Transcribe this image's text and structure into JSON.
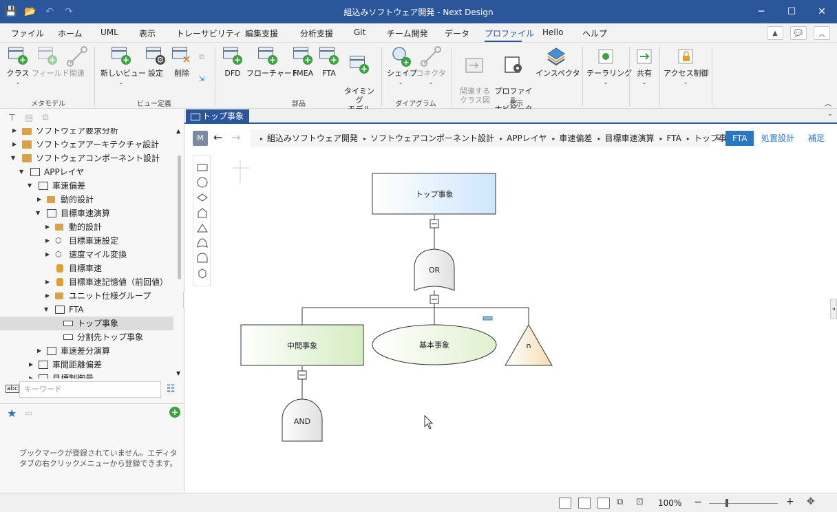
{
  "window": {
    "title": "組込みソフトウェア開発 - Next Design"
  },
  "menu": {
    "items": [
      "ファイル",
      "ホーム",
      "UML",
      "表示",
      "トレーサビリティ",
      "編集支援",
      "分析支援",
      "Git",
      "チーム開発",
      "データ",
      "プロファイル",
      "Hello",
      "ヘルプ"
    ],
    "active": "プロファイル"
  },
  "ribbon": {
    "groups": [
      {
        "label": "メタモデル",
        "buttons": [
          "クラス",
          "フィールド",
          "関連"
        ]
      },
      {
        "label": "ビュー定義",
        "buttons": [
          "新しいビュー",
          "設定",
          "削除"
        ]
      },
      {
        "label": "部品",
        "buttons": [
          "DFD",
          "フローチャート",
          "FMEA",
          "FTA",
          "タイミング\nモデル"
        ]
      },
      {
        "label": "ダイアグラム",
        "buttons": [
          "シェイプ",
          "コネクタ"
        ]
      },
      {
        "label": "表示",
        "buttons": [
          "関連する\nクラス図",
          "プロファイル\nナビゲータ",
          "インスペクタ"
        ]
      },
      {
        "label": "",
        "buttons": [
          "テーラリング"
        ]
      },
      {
        "label": "",
        "buttons": [
          "共有"
        ]
      },
      {
        "label": "",
        "buttons": [
          "アクセス制御"
        ]
      }
    ]
  },
  "tree": [
    "ソフトウェア要求分析",
    "ソフトウェアアーキテクチャ設計",
    "ソフトウェアコンポーネント設計",
    "APPレイヤ",
    "車速偏差",
    "動的設計",
    "目標車速演算",
    "動的設計",
    "目標車速設定",
    "速度マイル変換",
    "目標車速",
    "目標車速記憶値（前回値）",
    "ユニット仕様グループ",
    "FTA",
    "トップ事象",
    "分割先トップ事象",
    "車速差分演算",
    "車間距離偏差",
    "目標制御量"
  ],
  "search": {
    "placeholder": "キーワード"
  },
  "bookmarks": {
    "empty_message": "ブックマークが登録されていません。エディタタブの右クリックメニューから登録できます。"
  },
  "editor": {
    "tab": "トップ事象",
    "badge": "M",
    "breadcrumb": [
      "組込みソフトウェア開発",
      "ソフトウェアコンポーネント設計",
      "APPレイヤ",
      "車速偏差",
      "目標車速演算",
      "FTA",
      "トップ事象"
    ],
    "more": "»",
    "view_tabs": [
      "FTA",
      "処置設計",
      "補足"
    ],
    "active_view": "FTA"
  },
  "diagram": {
    "top_event": "トップ事象",
    "or_gate": "OR",
    "intermediate": "中間事象",
    "basic": "基本事象",
    "undeveloped": "n",
    "and_gate": "AND"
  },
  "statusbar": {
    "zoom": "100%"
  },
  "colors": {
    "accent": "#2b579a",
    "link": "#2b78c2"
  }
}
